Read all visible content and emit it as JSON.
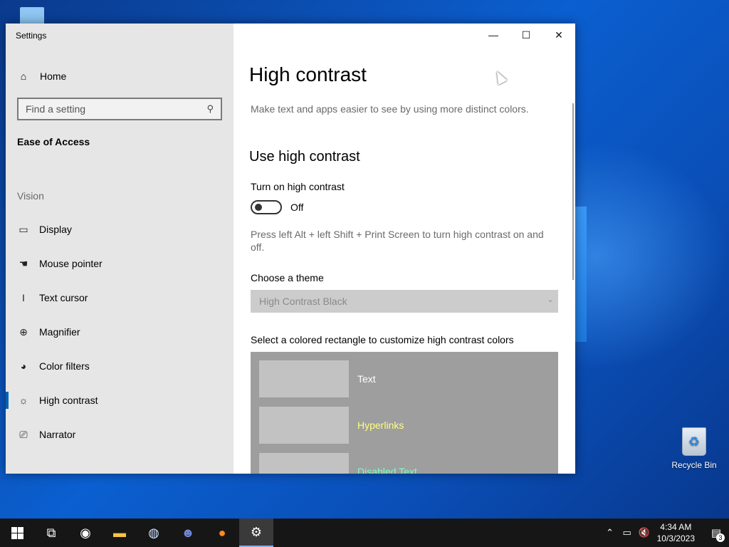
{
  "window": {
    "title": "Settings",
    "controls": {
      "minimize": "—",
      "maximize": "☐",
      "close": "✕"
    }
  },
  "sidebar": {
    "home_label": "Home",
    "search_placeholder": "Find a setting",
    "section_title": "Ease of Access",
    "group_label": "Vision",
    "items": [
      {
        "label": "Display",
        "icon": "monitor-icon",
        "glyph": "▭"
      },
      {
        "label": "Mouse pointer",
        "icon": "pointer-hand-icon",
        "glyph": "☚"
      },
      {
        "label": "Text cursor",
        "icon": "text-cursor-icon",
        "glyph": "I"
      },
      {
        "label": "Magnifier",
        "icon": "magnifier-icon",
        "glyph": "⊕"
      },
      {
        "label": "Color filters",
        "icon": "palette-icon",
        "glyph": "◕"
      },
      {
        "label": "High contrast",
        "icon": "sun-icon",
        "glyph": "☼"
      },
      {
        "label": "Narrator",
        "icon": "narrator-icon",
        "glyph": "⎚"
      }
    ]
  },
  "main": {
    "title": "High contrast",
    "description": "Make text and apps easier to see by using more distinct colors.",
    "section_heading": "Use high contrast",
    "toggle_label": "Turn on high contrast",
    "toggle_state": "Off",
    "shortcut_hint": "Press left Alt + left Shift + Print Screen to turn high contrast on and off.",
    "theme_label": "Choose a theme",
    "theme_value": "High Contrast Black",
    "colors_label": "Select a colored rectangle to customize high contrast colors",
    "color_rows": [
      {
        "label": "Text",
        "color": "#ffffff"
      },
      {
        "label": "Hyperlinks",
        "color": "#ffff80"
      },
      {
        "label": "Disabled Text",
        "color": "#7fffbf"
      }
    ]
  },
  "desktop": {
    "recycle_bin_label": "Recycle Bin"
  },
  "taskbar": {
    "time": "4:34 AM",
    "date": "10/3/2023",
    "notification_count": "3"
  },
  "colors": {
    "accent": "#0063b1",
    "sidebar_bg": "#e6e6e6",
    "taskbar_bg": "#161616"
  }
}
